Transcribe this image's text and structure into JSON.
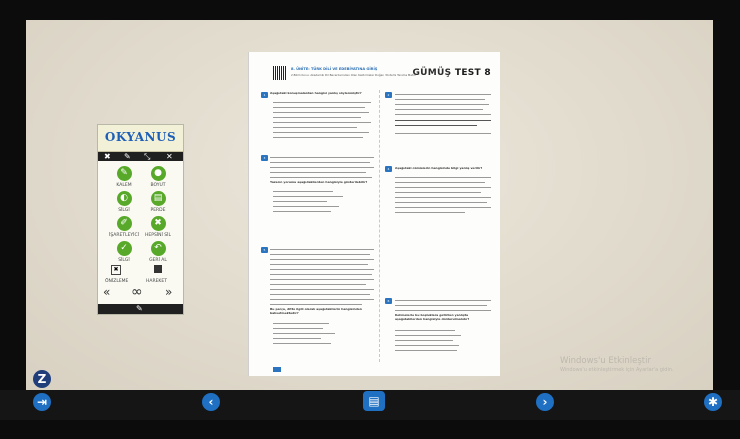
{
  "toolbar": {
    "brand": "OKYANUS",
    "tools": [
      {
        "label": "KALEM",
        "icon": "pen-icon",
        "glyph": "✎"
      },
      {
        "label": "BOYUT",
        "icon": "brush-icon",
        "glyph": "●"
      },
      {
        "label": "SİLGİ",
        "icon": "eraser-icon",
        "glyph": "◐"
      },
      {
        "label": "PERDE",
        "icon": "curtain-icon",
        "glyph": "▤"
      },
      {
        "label": "İŞARETLEYİCİ",
        "icon": "marker-icon",
        "glyph": "✐"
      },
      {
        "label": "HEPSİNİ SİL",
        "icon": "clear-all-icon",
        "glyph": "✖"
      },
      {
        "label": "SİLGİ",
        "icon": "eraser-2-icon",
        "glyph": "✓"
      },
      {
        "label": "GERİ AL",
        "icon": "undo-icon",
        "glyph": "↶"
      }
    ],
    "preview_label": "ÖNİZLEME",
    "move_label": "HAREKET"
  },
  "page": {
    "unit": "8. ÜNİTE: TÜRK DİLİ VE EDEBİYATINA GİRİŞ",
    "subunit": "2.Bilim Konu: Akademik Dil Becerilerinden Olan Kaldırmalar Doğan Yöntemi Tanıma Metni",
    "test_prefix": "GÜMÜŞ",
    "test_label": "TEST 8",
    "questions": [
      {
        "no": "1",
        "stem": "Aşağıdaki konuşmalardan hangisi yanlış söylenmiştir?"
      },
      {
        "no": "2",
        "stem": "Aşağıdaki cümlelerin hangisinde bilgi yanlış verilir?"
      },
      {
        "no": "3",
        "stem": "Yazarın yorumu aşağıdakilerden hangisiyle gösterilebilir?"
      },
      {
        "no": "4",
        "stem": "Aşağıdaki cümlelerin hangisinde bilgi yanlış verilir?"
      },
      {
        "no": "5",
        "stem": "Bu parça, ditto ilgili olarak aşağıdakilerin hangisinden bahsetmektedir?"
      },
      {
        "no": "6",
        "stem": "Kelimelerle bu boşluklara getirilen yanlışta aşağıdakilerden hangisiyle doldurulmalıdır?"
      }
    ]
  },
  "watermark": {
    "title": "Windows'u Etkinleştir",
    "subtitle": "Windows'u etkinleştirmek için Ayarlar'a gidin."
  },
  "nav": {
    "prev": "‹",
    "next": "›",
    "menu": "▤",
    "logo": "Z",
    "exit": "⇥",
    "settings": "✱",
    "preview_prev": "«",
    "preview_next": "»",
    "preview_glasses": "∞",
    "pen_glyph": "✎"
  },
  "colors": {
    "accent_blue": "#1f6fc2",
    "tool_green": "#58a92a",
    "brand_blue": "#1d5fb8"
  }
}
